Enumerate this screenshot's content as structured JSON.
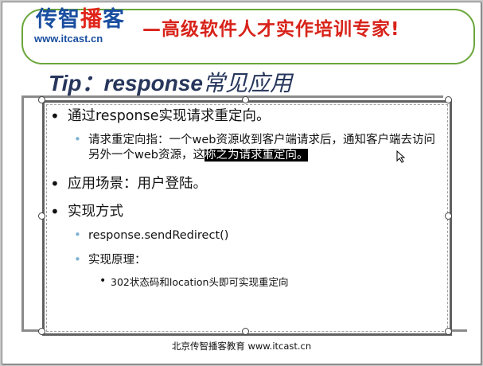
{
  "banner": {
    "logo_part1": "传智",
    "logo_part2": "播",
    "logo_part3": "客",
    "url": "www.itcast.cn",
    "slogan": "—高级软件人才实作培训专家!"
  },
  "slide": {
    "title_latin": "Tip：response",
    "title_cjk": "常见应用",
    "bullets": [
      {
        "text": "通过response实现请求重定向。"
      },
      {
        "text_before": "请求重定向指：一个web资源收到客户端请求后，通知客户端去访问另外一个web资源，这",
        "text_selected": "称之为请求重定向。"
      },
      {
        "text": "应用场景：用户登陆。"
      },
      {
        "text": "实现方式"
      },
      {
        "text": "response.sendRedirect()"
      },
      {
        "text": "实现原理："
      },
      {
        "text": "302状态码和location头即可实现重定向"
      }
    ],
    "footer": "北京传智播客教育 www.itcast.cn"
  },
  "colors": {
    "logo_blue": "#1a4ea0",
    "logo_red": "#e0261b",
    "slogan_red": "#d8231a",
    "title": "#27365c",
    "sub_bullet": "#7fb3d5"
  }
}
